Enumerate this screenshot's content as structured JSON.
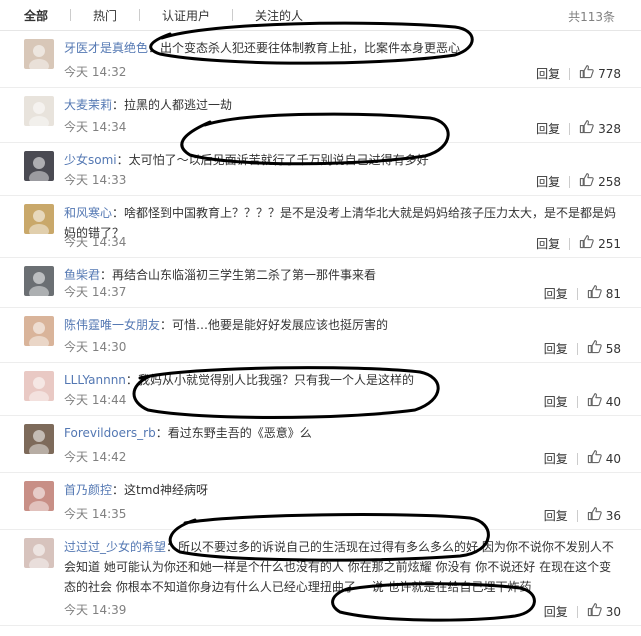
{
  "tabs": {
    "all": "全部",
    "hot": "热门",
    "verified": "认证用户",
    "following": "关注的人",
    "total": "共113条"
  },
  "labels": {
    "reply": "回复"
  },
  "comments": [
    {
      "user": "牙医才是真绝色",
      "text": "出个变态杀人犯还要往体制教育上扯，比案件本身更恶心",
      "time": "今天 14:32",
      "likes": "778",
      "avatar_color": "#d8c7b8"
    },
    {
      "user": "大麦茉莉",
      "text": "拉黑的人都逃过一劫",
      "time": "今天 14:34",
      "likes": "328",
      "avatar_color": "#e8e3dc"
    },
    {
      "user": "少女somi",
      "text": "太可怕了～以后见面诉苦就行了千万别说自己过得有多好",
      "time": "今天 14:33",
      "likes": "258",
      "avatar_color": "#4a4a52"
    },
    {
      "user": "和风寒心",
      "text": "啥都怪到中国教育上？？？？是不是没考上清华北大就是妈妈给孩子压力太大，是不是都是妈妈的错了？",
      "time": "今天 14:34",
      "likes": "251",
      "avatar_color": "#c9a86a"
    },
    {
      "user": "鱼柴君",
      "text": "再结合山东临淄初三学生第二杀了第一那件事来看",
      "time": "今天 14:37",
      "likes": "81",
      "avatar_color": "#6b6f73"
    },
    {
      "user": "陈伟霆唯一女朋友",
      "text": "可惜…他要是能好好发展应该也挺厉害的",
      "time": "今天 14:30",
      "likes": "58",
      "avatar_color": "#d9b49a"
    },
    {
      "user": "LLLYannnn",
      "text": "我妈从小就觉得别人比我强？只有我一个人是这样的",
      "time": "今天 14:44",
      "likes": "40",
      "avatar_color": "#e9c9c4"
    },
    {
      "user": "Forevildoers_rb",
      "text": "看过东野圭吾的《恶意》么",
      "time": "今天 14:42",
      "likes": "40",
      "avatar_color": "#7d6a5a"
    },
    {
      "user": "首乃颜控",
      "text": "这tmd神经病呀",
      "time": "今天 14:35",
      "likes": "36",
      "avatar_color": "#c88f86"
    },
    {
      "user": "过过过_少女的希望",
      "text": "所以不要过多的诉说自己的生活现在过得有多么多么的好 因为你不说你不发别人不会知道 她可能认为你还和她一样是个什么也没有的人 你在那之前炫耀 你没有 你不说还好 在现在这个变态的社会 你根本不知道你身边有什么人已经心理扭曲了 一说 也许就是在给自己埋下炸药",
      "time": "今天 14:39",
      "likes": "30",
      "avatar_color": "#d7c3bd"
    }
  ]
}
